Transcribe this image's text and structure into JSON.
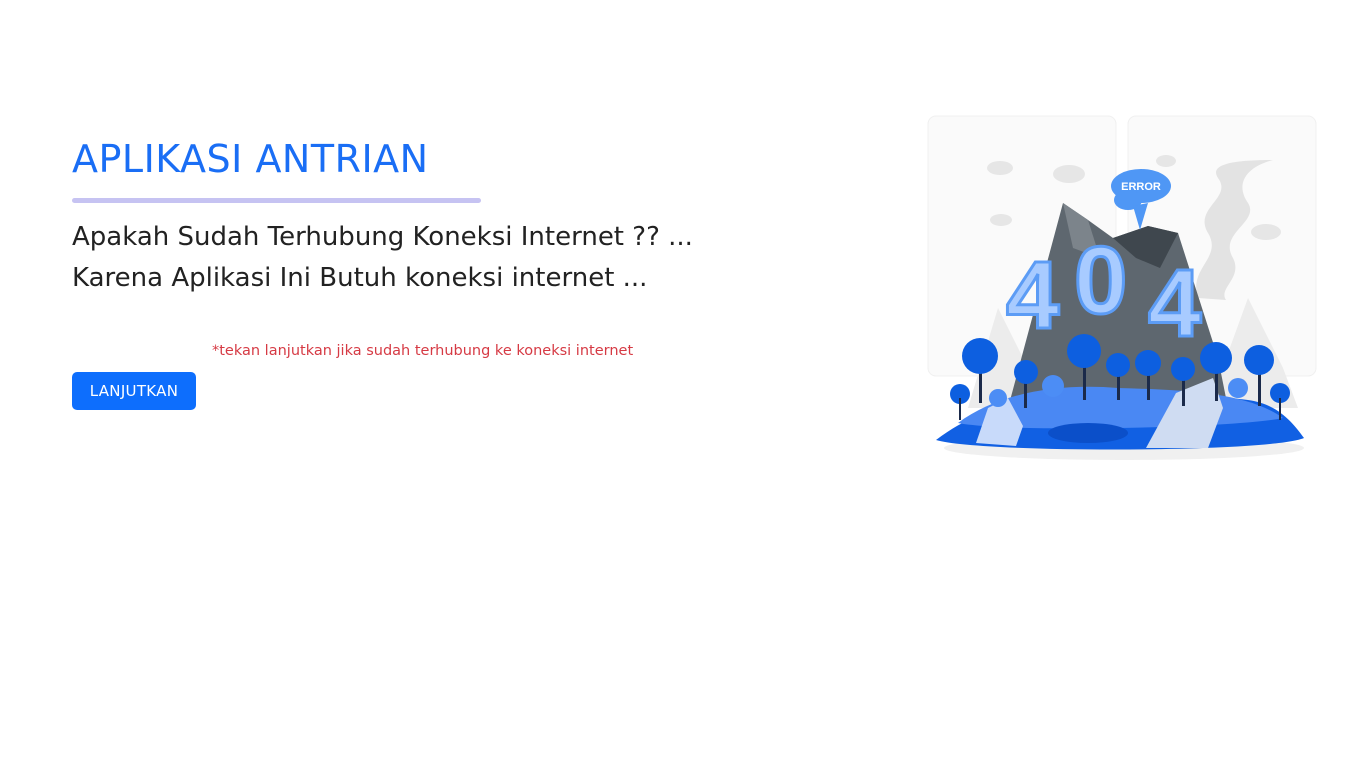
{
  "app": {
    "title": "APLIKASI ANTRIAN"
  },
  "message": {
    "line1": "Apakah Sudah Terhubung Koneksi Internet ?? ...",
    "line2": "Karena Aplikasi Ini Butuh koneksi internet ..."
  },
  "hint": "*tekan lanjutkan jika sudah terhubung ke koneksi internet",
  "actions": {
    "continue_label": "LANJUTKAN"
  },
  "illustration": {
    "error_label": "ERROR",
    "code": [
      "4",
      "0",
      "4"
    ],
    "icon": "404-mountain-illustration"
  },
  "colors": {
    "accent": "#1a6ef5",
    "button": "#0d6efd",
    "hint": "#d63a44",
    "rule": "#c6c3f2"
  }
}
